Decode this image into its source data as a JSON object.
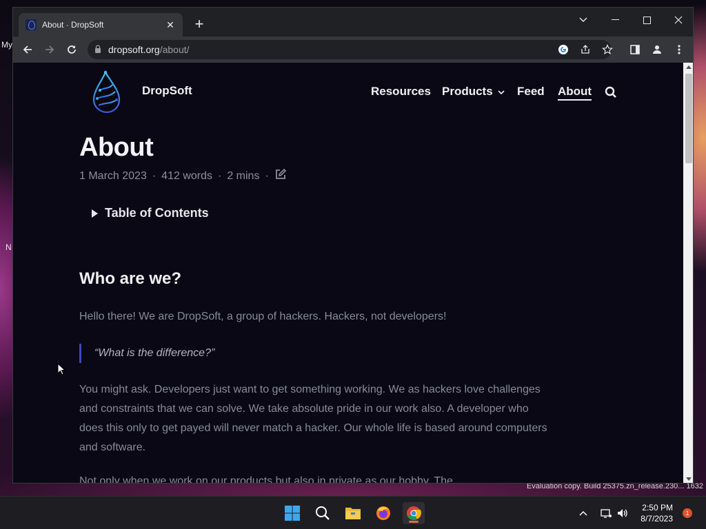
{
  "desktop": {
    "labels": [
      "My",
      "N"
    ],
    "watermark": "Evaluation copy. Build 25375.zn_release.230... 1632"
  },
  "browser": {
    "tab": {
      "title": "About · DropSoft",
      "close": "✕"
    },
    "new_tab": "+",
    "url": {
      "domain": "dropsoft.org",
      "path": "/about/"
    }
  },
  "site": {
    "brand": "DropSoft",
    "nav": [
      {
        "label": "Resources"
      },
      {
        "label": "Products"
      },
      {
        "label": "Feed"
      },
      {
        "label": "About",
        "active": true
      }
    ]
  },
  "article": {
    "title": "About",
    "date": "1 March 2023",
    "words": "412 words",
    "reading_time": "2 mins",
    "separator": "·",
    "toc_label": "Table of Contents",
    "heading": "Who are we?",
    "intro": "Hello there! We are DropSoft, a group of hackers. Hackers, not developers!",
    "quote": "“What is the difference?”",
    "body": "You might ask. Developers just want to get something working. We as hackers love challenges and constraints that we can solve. We take absolute pride in our work also. A developer who does this only to get payed will never match a hacker. Our whole life is based around computers and software.",
    "body_cut": "Not only when we work on our products but also in private as our hobby. The"
  },
  "taskbar": {
    "time": "2:50 PM",
    "date": "8/7/2023",
    "notifications": "1"
  },
  "colors": {
    "page_bg": "#0a0815",
    "quote_bar": "#3a48c0",
    "logo_gradient": [
      "#3ec8f0",
      "#3a5ae0"
    ]
  }
}
